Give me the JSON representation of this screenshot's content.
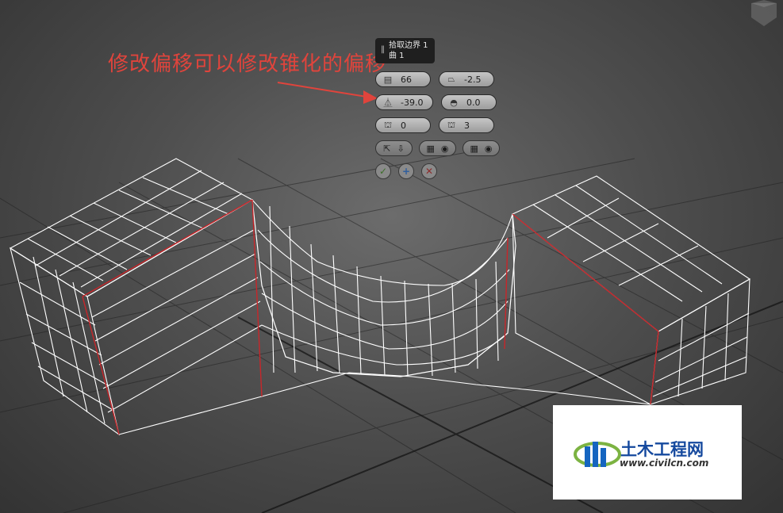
{
  "annotation": {
    "text": "修改偏移可以修改锥化的偏移"
  },
  "caddy": {
    "caption": {
      "line1": "拾取边界 1",
      "line2": "曲 1"
    },
    "fields": [
      {
        "name": "segments",
        "icon": "segments-icon",
        "glyph": "▤",
        "value": "66"
      },
      {
        "name": "taper",
        "icon": "taper-icon",
        "glyph": "⏢",
        "value": "-2.5"
      },
      {
        "name": "offset",
        "icon": "offset-icon",
        "glyph": "⏅",
        "value": "-39.0"
      },
      {
        "name": "smooth",
        "icon": "smooth-icon",
        "glyph": "◓",
        "value": "0.0"
      },
      {
        "name": "twist",
        "icon": "twist-icon",
        "glyph": "⛫",
        "value": "0"
      },
      {
        "name": "twist-count",
        "icon": "twist-count-icon",
        "glyph": "⛫",
        "value": "3"
      }
    ],
    "buttons": {
      "ok": "✓",
      "apply": "+",
      "cancel": "✕"
    }
  },
  "watermark": {
    "brand": "土木工程网",
    "url": "www.civilcn.com"
  },
  "colors": {
    "annotation": "#e0443c",
    "wireframe": "#ffffff",
    "edge_highlight": "#c8262a",
    "brand": "#15499e"
  }
}
